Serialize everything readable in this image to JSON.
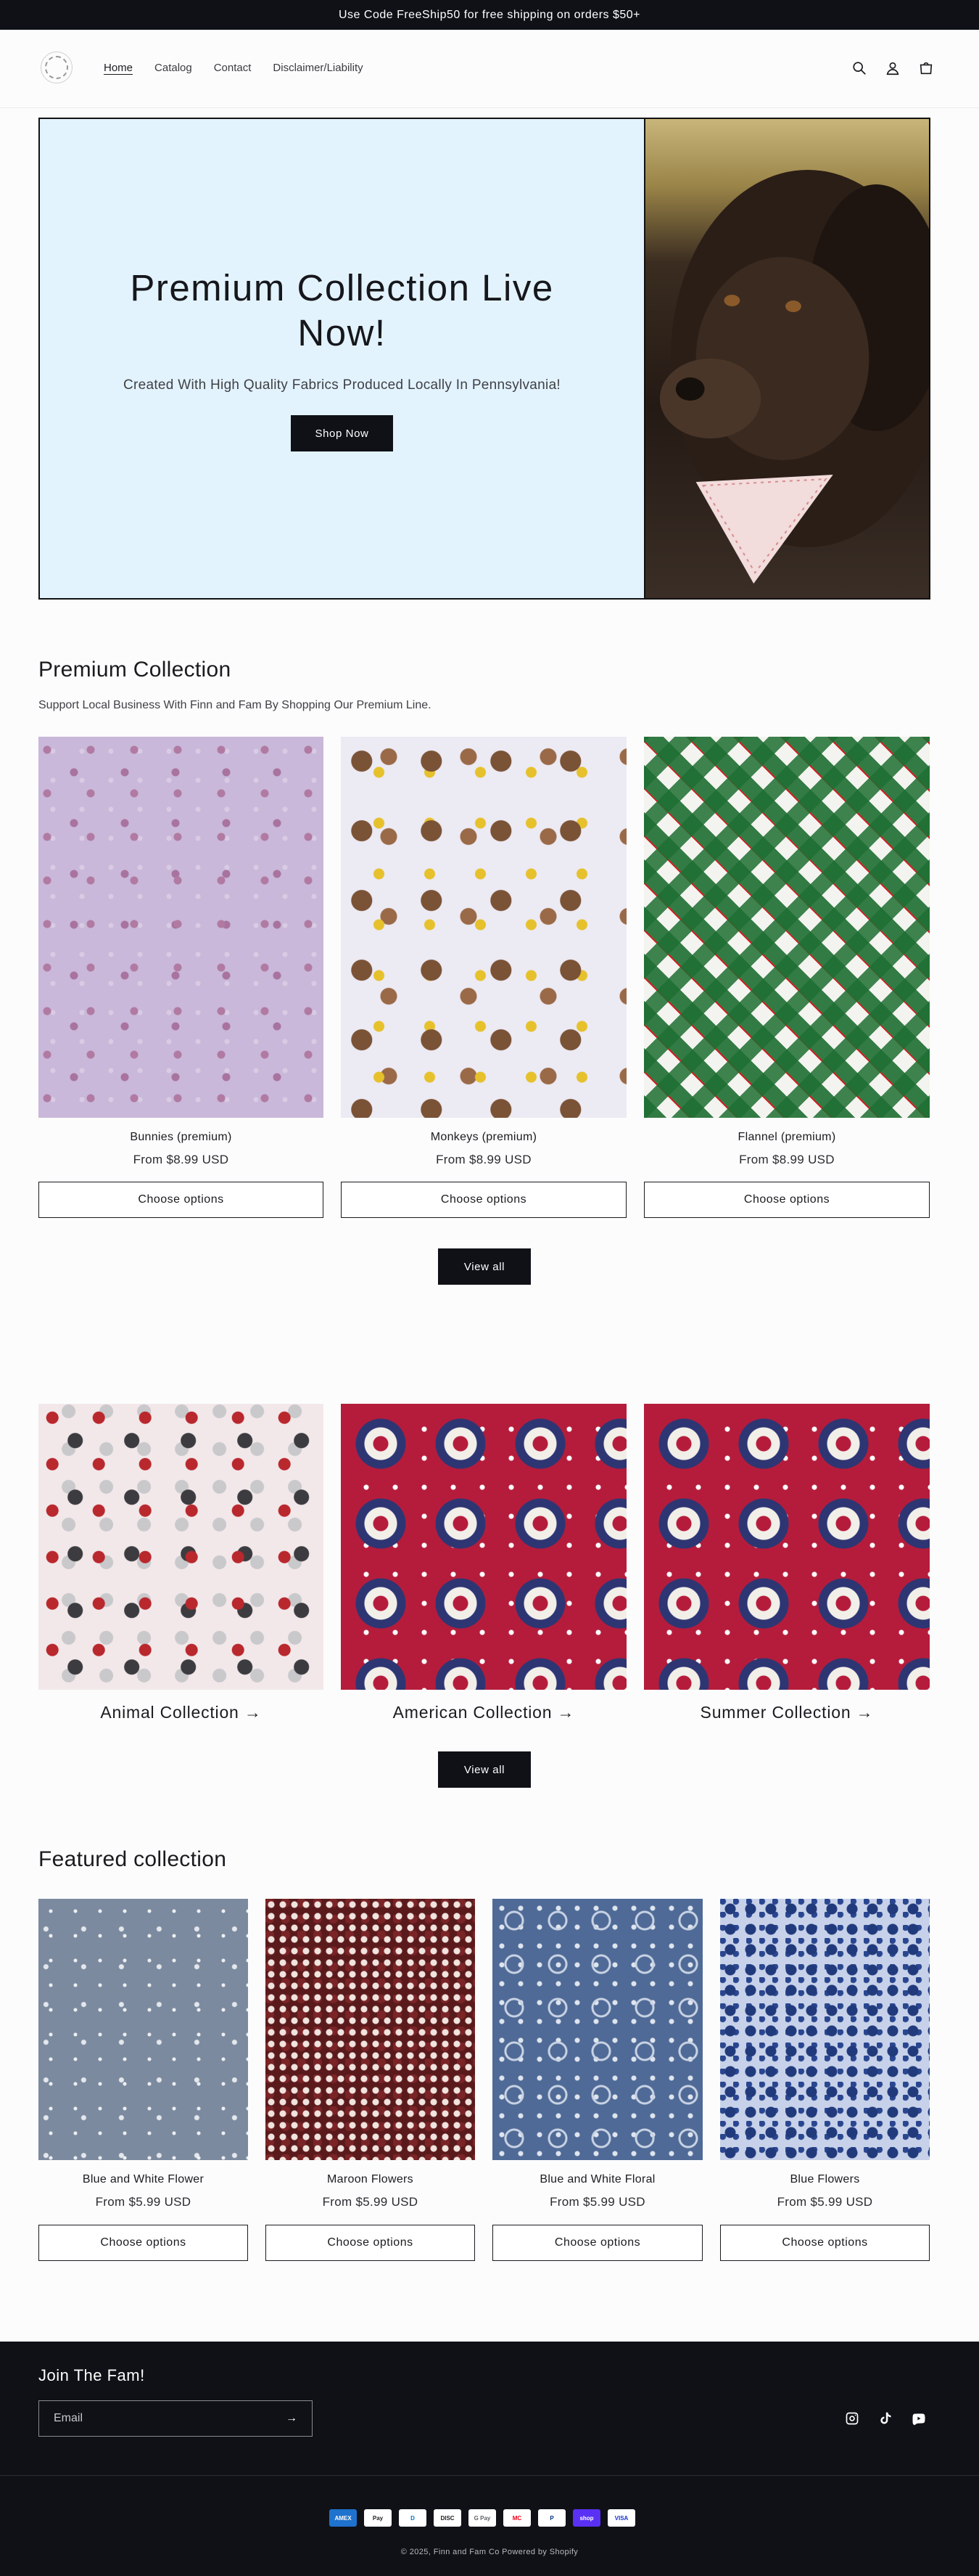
{
  "announcement": "Use Code FreeShip50 for free shipping on orders $50+",
  "nav": {
    "items": [
      "Home",
      "Catalog",
      "Contact",
      "Disclaimer/Liability"
    ]
  },
  "hero": {
    "title": "Premium Collection Live Now!",
    "subtitle": "Created With High Quality Fabrics Produced Locally In Pennsylvania!",
    "button": "Shop Now"
  },
  "premium": {
    "title": "Premium Collection",
    "description": "Support Local Business With Finn and Fam By Shopping Our Premium Line.",
    "products": [
      {
        "name": "Bunnies (premium)",
        "price": "From $8.99 USD",
        "button": "Choose options"
      },
      {
        "name": "Monkeys (premium)",
        "price": "From $8.99 USD",
        "button": "Choose options"
      },
      {
        "name": "Flannel (premium)",
        "price": "From $8.99 USD",
        "button": "Choose options"
      }
    ],
    "view_all": "View all"
  },
  "collections": {
    "items": [
      {
        "title": "Animal Collection →"
      },
      {
        "title": "American Collection →"
      },
      {
        "title": "Summer Collection →"
      }
    ],
    "view_all": "View all"
  },
  "featured": {
    "title": "Featured collection",
    "products": [
      {
        "name": "Blue and White Flower",
        "price": "From $5.99 USD",
        "button": "Choose options"
      },
      {
        "name": "Maroon Flowers",
        "price": "From $5.99 USD",
        "button": "Choose options"
      },
      {
        "name": "Blue and White Floral",
        "price": "From $5.99 USD",
        "button": "Choose options"
      },
      {
        "name": "Blue Flowers",
        "price": "From $5.99 USD",
        "button": "Choose options"
      }
    ]
  },
  "footer": {
    "join": "Join The Fam!",
    "email_placeholder": "Email",
    "payments": [
      "AMEX",
      "Pay",
      "D",
      "DISC",
      "G Pay",
      "MC",
      "P",
      "shop",
      "VISA"
    ],
    "copyright": "© 2025, Finn and Fam Co Powered by Shopify"
  },
  "icons": [
    "search-icon",
    "account-icon",
    "cart-icon",
    "instagram-icon",
    "tiktok-icon",
    "youtube-icon"
  ],
  "colors": {
    "dark": "#0f1117",
    "hero_bg": "#e3f3fd"
  }
}
